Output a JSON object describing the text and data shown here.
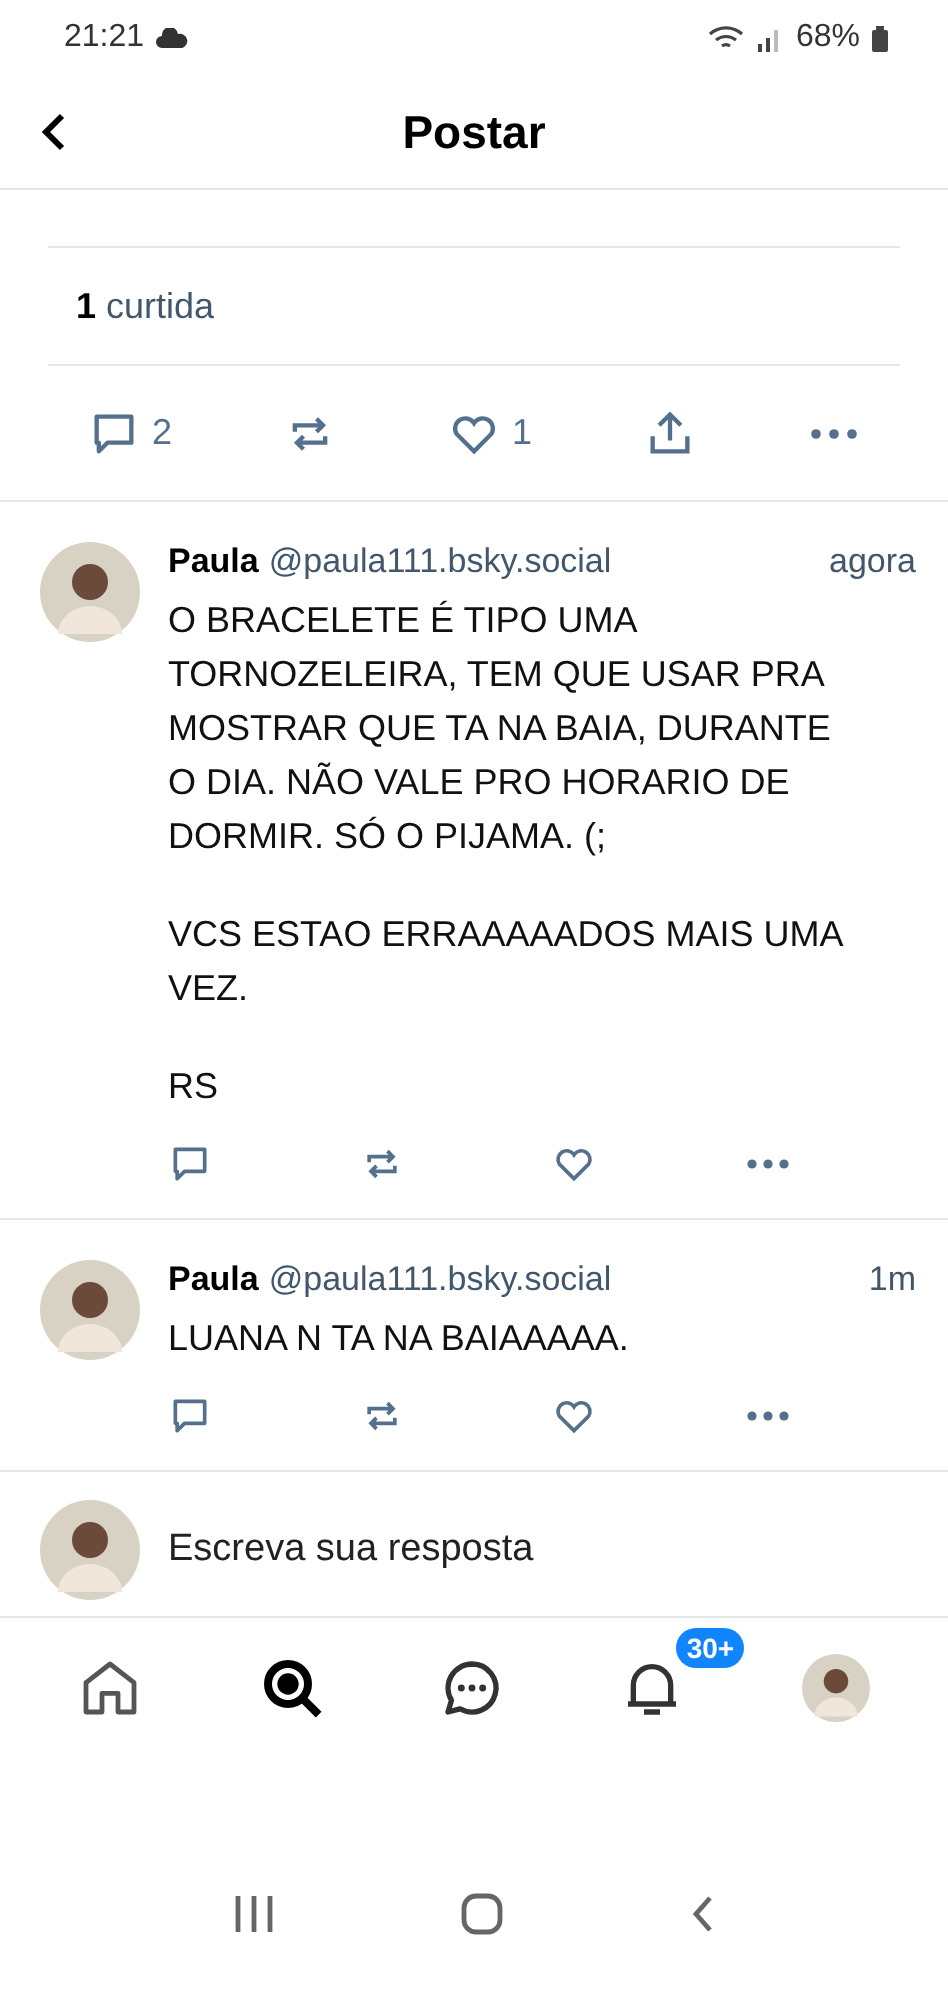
{
  "status_bar": {
    "time": "21:21",
    "battery": "68%"
  },
  "header": {
    "title": "Postar"
  },
  "likes": {
    "count": "1",
    "label": "curtida"
  },
  "main_actions": {
    "replies": "2",
    "likes": "1",
    "liked": false
  },
  "replies": [
    {
      "name": "Paula",
      "handle": "@paula111.bsky.social",
      "time": "agora",
      "paragraphs": [
        "O BRACELETE É TIPO UMA TORNOZELEIRA, TEM QUE USAR PRA MOSTRAR QUE TA NA BAIA, DURANTE O DIA. NÃO VALE PRO HORARIO DE DORMIR. SÓ O PIJAMA. (;",
        "VCS ESTAO ERRAAAAADOS MAIS UMA VEZ.",
        "RS"
      ],
      "liked": false
    },
    {
      "name": "Paula",
      "handle": "@paula111.bsky.social",
      "time": "1m",
      "paragraphs": [
        "LUANA N TA NA BAIAAAAA."
      ],
      "liked": false
    }
  ],
  "composer": {
    "placeholder": "Escreva sua resposta"
  },
  "bottom_nav": [
    {
      "kind": "home",
      "selected": false
    },
    {
      "kind": "search",
      "selected": true
    },
    {
      "kind": "chat",
      "selected": false
    },
    {
      "kind": "bell",
      "selected": false,
      "badge": "30+"
    },
    {
      "kind": "profile",
      "selected": false
    }
  ]
}
